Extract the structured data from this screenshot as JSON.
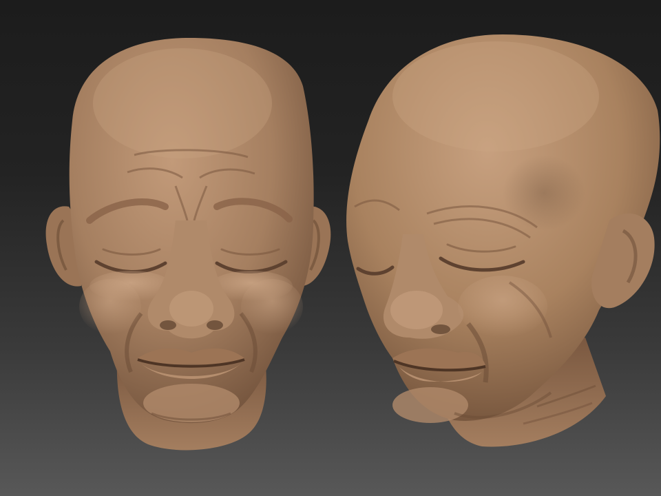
{
  "scene": {
    "background_top_color": "#1c1c1c",
    "background_bottom_color": "#585858",
    "material_color": "#a57f60",
    "material_highlight_color": "#c49c7b",
    "material_shadow_color": "#6b4c36",
    "objects": [
      {
        "name": "elderly-head-sculpt-front-view",
        "view": "front"
      },
      {
        "name": "elderly-head-sculpt-three-quarter-view",
        "view": "three-quarter"
      }
    ]
  }
}
